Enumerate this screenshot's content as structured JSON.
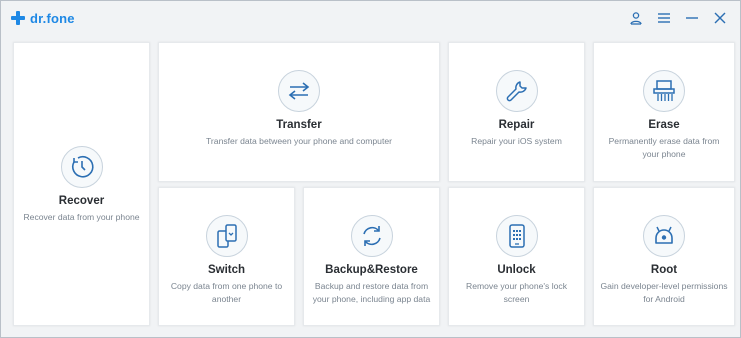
{
  "app": {
    "name": "dr.fone",
    "brand_color": "#1e88e5",
    "icon_color": "#2c6fb3"
  },
  "titlebar": {
    "controls": [
      {
        "icon": "user-icon"
      },
      {
        "icon": "menu-icon"
      },
      {
        "icon": "minimize-icon"
      },
      {
        "icon": "close-icon"
      }
    ]
  },
  "modules": {
    "recover": {
      "title": "Recover",
      "desc": "Recover data from your phone",
      "icon": "clock-icon"
    },
    "transfer": {
      "title": "Transfer",
      "desc": "Transfer data between your phone and computer",
      "icon": "transfer-arrows-icon"
    },
    "repair": {
      "title": "Repair",
      "desc": "Repair your iOS system",
      "icon": "wrench-icon"
    },
    "erase": {
      "title": "Erase",
      "desc": "Permanently erase data from your phone",
      "icon": "shredder-icon"
    },
    "switch": {
      "title": "Switch",
      "desc": "Copy data from one phone to another",
      "icon": "phone-switch-icon"
    },
    "backup": {
      "title": "Backup&Restore",
      "desc": "Backup and restore data from your phone, including app data",
      "icon": "sync-icon"
    },
    "unlock": {
      "title": "Unlock",
      "desc": "Remove your phone's lock screen",
      "icon": "phone-keypad-icon"
    },
    "root": {
      "title": "Root",
      "desc": "Gain developer-level permissions for Android",
      "icon": "android-icon"
    }
  }
}
